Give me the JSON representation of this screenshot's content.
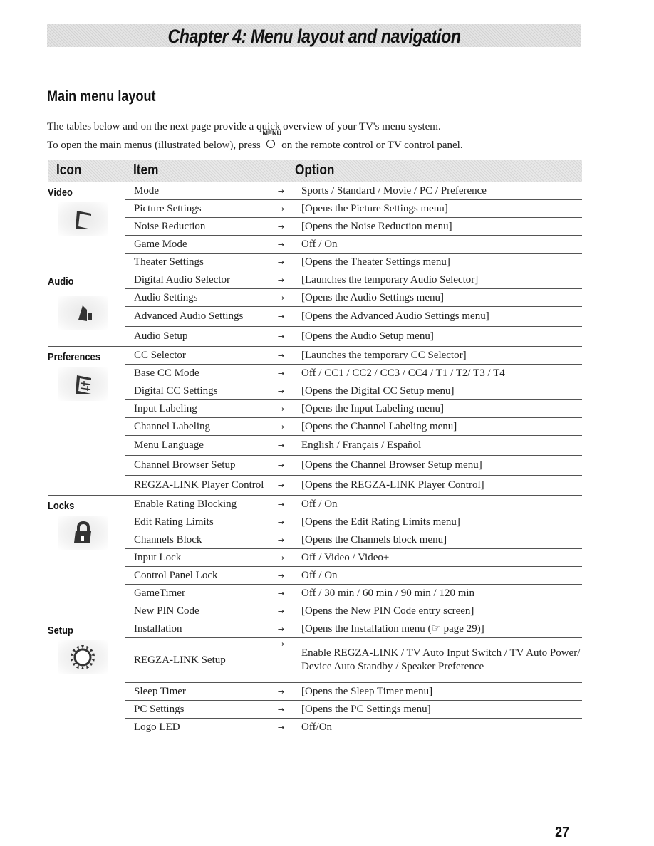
{
  "chapter_title": "Chapter 4: Menu layout and navigation",
  "section_title": "Main menu layout",
  "intro": {
    "line1": "The tables below and on the next page provide a quick overview of your TV's menu system.",
    "line2_before": "To open the main menus (illustrated below), press",
    "menu_button_label": "MENU",
    "line2_after": "on the remote control or TV control panel."
  },
  "table": {
    "headers": {
      "icon": "Icon",
      "item": "Item",
      "option": "Option"
    },
    "arrow": "→",
    "groups": [
      {
        "label": "Video",
        "icon": "video-icon",
        "rows": [
          {
            "item": "Mode",
            "option": "Sports / Standard / Movie / PC / Preference"
          },
          {
            "item": "Picture Settings",
            "option": "[Opens the Picture Settings menu]"
          },
          {
            "item": "Noise Reduction",
            "option": "[Opens the Noise Reduction menu]"
          },
          {
            "item": "Game Mode",
            "option": "Off / On"
          },
          {
            "item": "Theater Settings",
            "option": "[Opens the Theater Settings menu]"
          }
        ]
      },
      {
        "label": "Audio",
        "icon": "speaker-icon",
        "rows": [
          {
            "item": "Digital Audio Selector",
            "option": "[Launches the temporary Audio Selector]"
          },
          {
            "item": "Audio Settings",
            "option": "[Opens the Audio Settings menu]"
          },
          {
            "item": "Advanced Audio Settings",
            "option": "[Opens the Advanced Audio Settings menu]"
          },
          {
            "item": "Audio Setup",
            "option": "[Opens the Audio Setup menu]"
          }
        ]
      },
      {
        "label": "Preferences",
        "icon": "sliders-icon",
        "rows": [
          {
            "item": "CC Selector",
            "option": "[Launches the temporary CC Selector]"
          },
          {
            "item": "Base CC Mode",
            "option": "Off / CC1 / CC2 / CC3 / CC4 / T1 / T2/ T3 / T4"
          },
          {
            "item": "Digital CC Settings",
            "option": "[Opens the Digital CC Setup menu]"
          },
          {
            "item": "Input Labeling",
            "option": "[Opens the Input Labeling menu]"
          },
          {
            "item": "Channel Labeling",
            "option": "[Opens the Channel Labeling menu]"
          },
          {
            "item": "Menu Language",
            "option": "English / Français / Español"
          },
          {
            "item": "Channel Browser Setup",
            "option": "[Opens the Channel Browser Setup menu]"
          },
          {
            "item": "REGZA-LINK Player Control",
            "option": "[Opens the REGZA-LINK Player Control]"
          }
        ]
      },
      {
        "label": "Locks",
        "icon": "lock-icon",
        "rows": [
          {
            "item": "Enable Rating Blocking",
            "option": "Off / On"
          },
          {
            "item": "Edit Rating Limits",
            "option": "[Opens the Edit Rating Limits menu]"
          },
          {
            "item": "Channels Block",
            "option": "[Opens the Channels block menu]"
          },
          {
            "item": "Input Lock",
            "option": "Off / Video / Video+"
          },
          {
            "item": "Control Panel Lock",
            "option": "Off / On"
          },
          {
            "item": "GameTimer",
            "option": "Off / 30 min / 60 min / 90 min / 120 min"
          },
          {
            "item": "New PIN Code",
            "option": "[Opens the New PIN Code entry screen]"
          }
        ]
      },
      {
        "label": "Setup",
        "icon": "gear-icon",
        "rows": [
          {
            "item": "Installation",
            "option": "[Opens the Installation menu (☞ page 29)]"
          },
          {
            "item": "REGZA-LINK Setup",
            "option": "Enable REGZA-LINK / TV Auto Input Switch / TV Auto Power/ Device Auto Standby / Speaker Preference"
          },
          {
            "item": "Sleep Timer",
            "option": "[Opens the Sleep Timer menu]"
          },
          {
            "item": "PC Settings",
            "option": "[Opens the PC Settings menu]"
          },
          {
            "item": "Logo LED",
            "option": "Off/On"
          }
        ]
      }
    ]
  },
  "page_number": "27"
}
